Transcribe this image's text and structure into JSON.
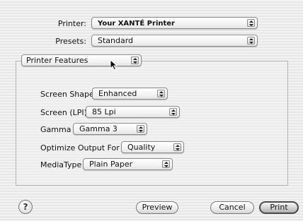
{
  "header": {
    "printer_label": "Printer:",
    "printer_value": "Your XANTÉ Printer",
    "presets_label": "Presets:",
    "presets_value": "Standard"
  },
  "section": {
    "selected": "Printer Features"
  },
  "features": {
    "screen_shape": {
      "label": "Screen Shape",
      "value": "Enhanced"
    },
    "screen_lpi": {
      "label": "Screen (LPI)",
      "value": "85 Lpi"
    },
    "gamma": {
      "label": "Gamma",
      "value": "Gamma 3"
    },
    "optimize": {
      "label": "Optimize Output For",
      "value": "Quality"
    },
    "media_type": {
      "label": "MediaType",
      "value": "Plain Paper"
    }
  },
  "footer": {
    "help_glyph": "?",
    "preview_label": "Preview",
    "cancel_label": "Cancel",
    "print_label": "Print"
  },
  "icons": [
    "popup-arrows-icon",
    "help-icon",
    "mouse-pointer-icon"
  ]
}
